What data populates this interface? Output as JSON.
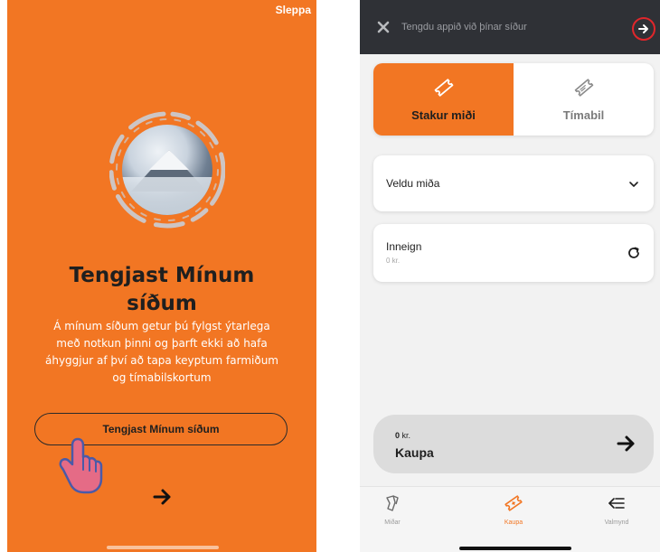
{
  "left": {
    "skip_label": "Sleppa",
    "title_line1": "Tengjast Mínum",
    "title_line2": "síðum",
    "description_line1": "Á mínum síðum getur þú fylgst ýtarlega",
    "description_line2": "með notkun þinni og þarft ekki að hafa",
    "description_line3": "áhyggjur af því að tapa keyptum farmiðum",
    "description_line4": "og tímabilskortum",
    "connect_button_label": "Tengjast Mínum síðum",
    "accent_color": "#F27623"
  },
  "right": {
    "topbar_text": "Tengdu appið við þínar síður",
    "ticket_types": [
      {
        "label": "Stakur miði",
        "icon": "ticket-icon",
        "active": true
      },
      {
        "label": "Tímabil",
        "icon": "calendar-ticket-icon",
        "active": false
      }
    ],
    "select_label": "Veldu miða",
    "balance_label": "Inneign",
    "balance_value": "0 kr.",
    "buy_amount_value": "0",
    "buy_amount_unit": "kr.",
    "buy_label": "Kaupa",
    "tabs": [
      {
        "label": "Miðar",
        "icon": "tickets-icon",
        "active": false
      },
      {
        "label": "Kaupa",
        "icon": "buy-ticket-icon",
        "active": true
      },
      {
        "label": "Valmynd",
        "icon": "menu-icon",
        "active": false
      }
    ],
    "highlight_color": "#e0262b"
  }
}
